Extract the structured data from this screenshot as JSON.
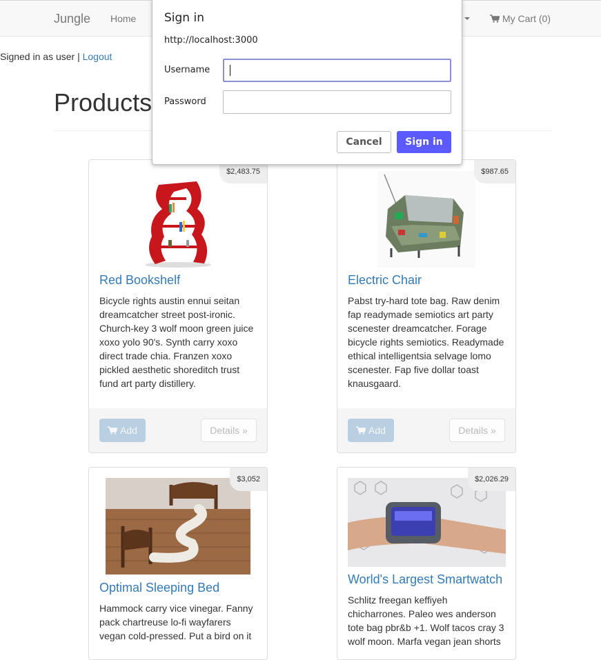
{
  "navbar": {
    "brand": "Jungle",
    "home": "Home",
    "cart": "My Cart (0)"
  },
  "session": {
    "signed_in_text": "Signed in as user |",
    "logout": "Logout"
  },
  "page": {
    "title": "Products"
  },
  "products": [
    {
      "name": "Red Bookshelf",
      "price": "$2,483.75",
      "description": "Bicycle rights austin ennui seitan dreamcatcher street post-ironic. Church-key 3 wolf moon green juice xoxo yolo 90's. Synth carry xoxo direct trade chia. Franzen xoxo pickled aesthetic shoreditch trust fund art party distillery.",
      "add_label": "Add",
      "details_label": "Details »"
    },
    {
      "name": "Electric Chair",
      "price": "$987.65",
      "description": "Pabst try-hard tote bag. Raw denim fap readymade semiotics art party scenester dreamcatcher. Forage bicycle rights semiotics. Readymade ethical intelligentsia selvage lomo scenester. Fap five dollar toast knausgaard.",
      "add_label": "Add",
      "details_label": "Details »"
    },
    {
      "name": "Optimal Sleeping Bed",
      "price": "$3,052",
      "description": "Hammock carry vice vinegar. Fanny pack chartreuse lo-fi wayfarers vegan cold-pressed. Put a bird on it"
    },
    {
      "name": "World's Largest Smartwatch",
      "price": "$2,026.29",
      "description": "Schlitz freegan keffiyeh chicharrones. Paleo wes anderson tote bag pbr&b +1. Wolf tacos cray 3 wolf moon. Marfa vegan jean shorts"
    }
  ],
  "dialog": {
    "title": "Sign in",
    "url": "http://localhost:3000",
    "username_label": "Username",
    "password_label": "Password",
    "username_value": "",
    "password_value": "",
    "cancel": "Cancel",
    "signin": "Sign in"
  },
  "colors": {
    "link": "#337ab7",
    "signin_button": "#5a5aff"
  },
  "icons": [
    "shopping-cart-icon",
    "caret-down-icon"
  ]
}
